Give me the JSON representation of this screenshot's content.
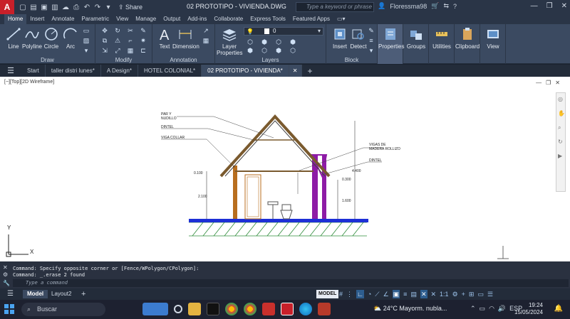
{
  "titlebar": {
    "logo": "A",
    "share": "Share",
    "document": "02 PROTOTIPO - VIVIENDA.DWG",
    "search_placeholder": "Type a keyword or phrase",
    "user": "Floressma98",
    "window_controls": [
      "—",
      "❐",
      "✕"
    ]
  },
  "ribbon_tabs": [
    "Home",
    "Insert",
    "Annotate",
    "Parametric",
    "View",
    "Manage",
    "Output",
    "Add-ins",
    "Collaborate",
    "Express Tools",
    "Featured Apps"
  ],
  "ribbon": {
    "draw": {
      "title": "Draw",
      "tools": [
        "Line",
        "Polyline",
        "Circle",
        "Arc"
      ]
    },
    "modify": {
      "title": "Modify"
    },
    "annotation": {
      "title": "Annotation",
      "tools": [
        "Text",
        "Dimension"
      ]
    },
    "layers": {
      "title": "Layers",
      "tool": "Layer Properties",
      "layer_value": "0"
    },
    "block": {
      "title": "Block",
      "tools": [
        "Insert",
        "Detect"
      ]
    },
    "right_tools": [
      "Properties",
      "Groups",
      "Utilities",
      "Clipboard",
      "View"
    ]
  },
  "file_tabs": [
    "Start",
    "taller distri lunes*",
    "A Design*",
    "HOTEL COLONIAL*",
    "02 PROTOTIPO - VIVIENDA*"
  ],
  "viewport": {
    "label": "[−][Top][2D Wireframe]",
    "ucs_y": "Y",
    "ucs_x": "X"
  },
  "drawing": {
    "labels": {
      "par_y_nudillo": "PAR Y NUDILLO",
      "dintel_left": "DINTEL",
      "viga_collar": "VIGA COLLAR",
      "vigas_madera": "VIGAS DE MADERA ROLLIZO",
      "dintel_right": "DINTEL"
    },
    "dims": {
      "d1": "0.100",
      "d2": "2.100",
      "d3": "0.300",
      "d4": "1.600",
      "d5": "4.400"
    }
  },
  "command": {
    "history": [
      "Command: Specify opposite corner or [Fence/WPolygon/CPolygon]:",
      "Command: _.erase 2 found"
    ],
    "placeholder": "Type a command"
  },
  "layout_tabs": [
    "Model",
    "Layout2"
  ],
  "status": {
    "model": "MODEL",
    "scale": "1:1"
  },
  "taskbar": {
    "search": "Buscar",
    "weather": "24°C  Mayorm. nubla...",
    "lang": "ESP",
    "time": "19:24",
    "date": "15/05/2024"
  },
  "colors": {
    "accent": "#2d5d8e",
    "autocad_red": "#c8202a",
    "wall": "#b86e1e",
    "stair": "#8e1ba6",
    "floor": "#1d2fd6",
    "ground": "#2e8c3a"
  }
}
